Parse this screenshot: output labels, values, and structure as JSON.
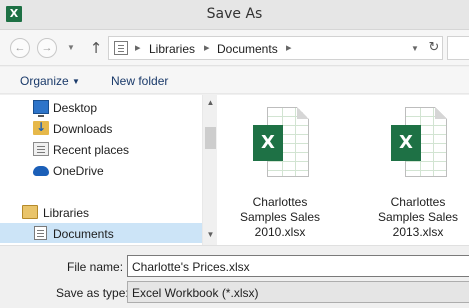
{
  "window": {
    "title": "Save As",
    "app_icon": "excel-icon"
  },
  "navigation": {
    "back": "back-icon",
    "forward": "forward-icon",
    "up": "up-arrow-icon",
    "refresh": "refresh-icon",
    "breadcrumb": [
      "Libraries",
      "Documents"
    ]
  },
  "toolbar": {
    "organize_label": "Organize",
    "new_folder_label": "New folder"
  },
  "sidebar": {
    "items": [
      {
        "label": "Desktop",
        "icon": "desktop-icon"
      },
      {
        "label": "Downloads",
        "icon": "downloads-icon"
      },
      {
        "label": "Recent places",
        "icon": "recent-places-icon"
      },
      {
        "label": "OneDrive",
        "icon": "onedrive-icon"
      },
      {
        "label": "Libraries",
        "icon": "libraries-icon"
      },
      {
        "label": "Documents",
        "icon": "documents-icon",
        "selected": true
      }
    ]
  },
  "files": [
    {
      "line1": "Charlottes",
      "line2": "Samples Sales",
      "line3": "2010.xlsx",
      "icon": "excel-file-icon"
    },
    {
      "line1": "Charlottes",
      "line2": "Samples Sales",
      "line3": "2013.xlsx",
      "icon": "excel-file-icon"
    }
  ],
  "form": {
    "file_name_label": "File name:",
    "file_name_value": "Charlotte's Prices.xlsx",
    "save_as_type_label": "Save as type:",
    "save_as_type_value": "Excel Workbook (*.xlsx)"
  },
  "colors": {
    "excel_green": "#1e7145",
    "selection": "#cce4f7",
    "command_text": "#1a3a6a"
  }
}
